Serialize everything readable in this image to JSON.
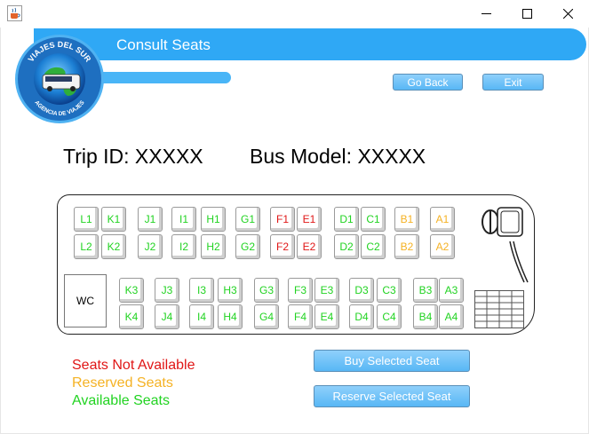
{
  "window": {
    "app_icon": "java-coffee-cup-icon",
    "controls": [
      "minimize-icon",
      "maximize-icon",
      "close-icon"
    ]
  },
  "header": {
    "title": "Consult Seats",
    "logo": {
      "top_text": "VIAJES DEL SUR",
      "bottom_text": "AGENCIA DE VIAJES"
    },
    "go_back_label": "Go Back",
    "exit_label": "Exit"
  },
  "trip": {
    "trip_id_text": "Trip ID: XXXXX",
    "bus_model_text": "Bus Model: XXXXX"
  },
  "bus": {
    "wc_label": "WC",
    "upper_block": {
      "row1": [
        {
          "label": "L1",
          "status": "available"
        },
        {
          "label": "K1",
          "status": "available"
        },
        {
          "label": "J1",
          "status": "available"
        },
        {
          "label": "I1",
          "status": "available"
        },
        {
          "label": "H1",
          "status": "available"
        },
        {
          "label": "G1",
          "status": "available"
        },
        {
          "label": "F1",
          "status": "unavailable"
        },
        {
          "label": "E1",
          "status": "unavailable"
        },
        {
          "label": "D1",
          "status": "available"
        },
        {
          "label": "C1",
          "status": "available"
        },
        {
          "label": "B1",
          "status": "reserved"
        },
        {
          "label": "A1",
          "status": "reserved"
        }
      ],
      "row2": [
        {
          "label": "L2",
          "status": "available"
        },
        {
          "label": "K2",
          "status": "available"
        },
        {
          "label": "J2",
          "status": "available"
        },
        {
          "label": "I2",
          "status": "available"
        },
        {
          "label": "H2",
          "status": "available"
        },
        {
          "label": "G2",
          "status": "available"
        },
        {
          "label": "F2",
          "status": "unavailable"
        },
        {
          "label": "E2",
          "status": "unavailable"
        },
        {
          "label": "D2",
          "status": "available"
        },
        {
          "label": "C2",
          "status": "available"
        },
        {
          "label": "B2",
          "status": "reserved"
        },
        {
          "label": "A2",
          "status": "reserved"
        }
      ]
    },
    "lower_block": {
      "row3": [
        {
          "label": "K3",
          "status": "available"
        },
        {
          "label": "J3",
          "status": "available"
        },
        {
          "label": "I3",
          "status": "available"
        },
        {
          "label": "H3",
          "status": "available"
        },
        {
          "label": "G3",
          "status": "available"
        },
        {
          "label": "F3",
          "status": "available"
        },
        {
          "label": "E3",
          "status": "available"
        },
        {
          "label": "D3",
          "status": "available"
        },
        {
          "label": "C3",
          "status": "available"
        },
        {
          "label": "B3",
          "status": "available"
        },
        {
          "label": "A3",
          "status": "available"
        }
      ],
      "row4": [
        {
          "label": "K4",
          "status": "available"
        },
        {
          "label": "J4",
          "status": "available"
        },
        {
          "label": "I4",
          "status": "available"
        },
        {
          "label": "H4",
          "status": "available"
        },
        {
          "label": "G4",
          "status": "available"
        },
        {
          "label": "F4",
          "status": "available"
        },
        {
          "label": "E4",
          "status": "available"
        },
        {
          "label": "D4",
          "status": "available"
        },
        {
          "label": "C4",
          "status": "available"
        },
        {
          "label": "B4",
          "status": "available"
        },
        {
          "label": "A4",
          "status": "available"
        }
      ]
    }
  },
  "legend": {
    "not_available": "Seats Not Available",
    "reserved": "Reserved Seats",
    "available": "Available Seats"
  },
  "actions": {
    "buy_label": "Buy Selected Seat",
    "reserve_label": "Reserve Selected Seat"
  },
  "colors": {
    "banner": "#2fa8f5",
    "button": "#58b7f5",
    "available": "#22d322",
    "reserved": "#f5b224",
    "unavailable": "#e01616"
  }
}
